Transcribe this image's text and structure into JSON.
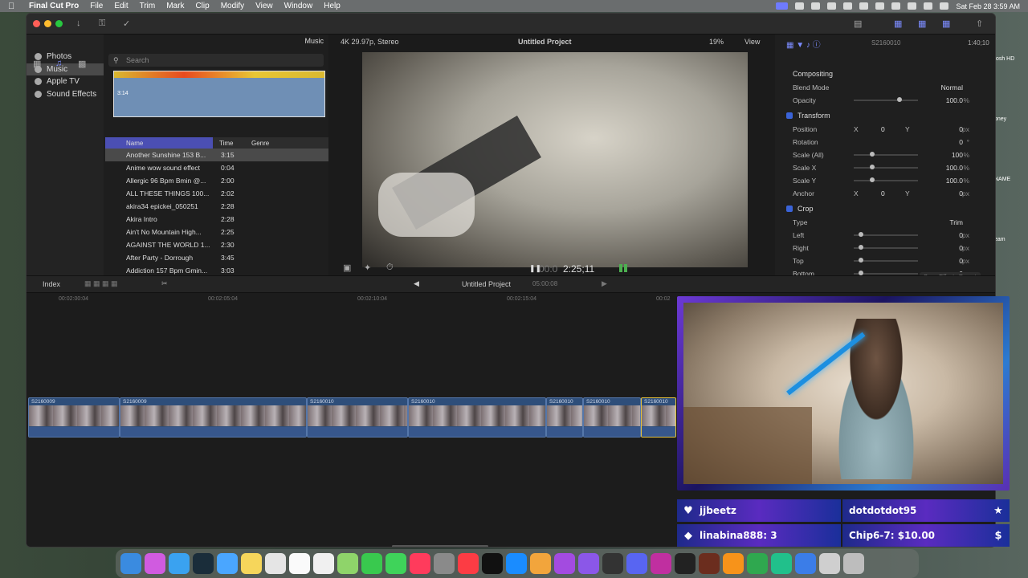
{
  "menubar": {
    "app": "Final Cut Pro",
    "items": [
      "File",
      "Edit",
      "Trim",
      "Mark",
      "Clip",
      "Modify",
      "View",
      "Window",
      "Help"
    ],
    "clock": "Sat Feb 28  3:59 AM"
  },
  "browser": {
    "sidebar": [
      "Photos",
      "Music",
      "Apple TV",
      "Sound Effects"
    ],
    "library_label": "Music",
    "search_placeholder": "Search",
    "waveform_time": "3:14",
    "columns": {
      "name": "Name",
      "time": "Time",
      "genre": "Genre"
    },
    "songs": [
      {
        "name": "Another Sunshine 153 B...",
        "time": "3:15"
      },
      {
        "name": "Anime wow sound effect",
        "time": "0:04"
      },
      {
        "name": "Allergic 96 Bpm Bmin @...",
        "time": "2:00"
      },
      {
        "name": "ALL THESE THINGS 100...",
        "time": "2:02"
      },
      {
        "name": "akira34 epickei_050251",
        "time": "2:28"
      },
      {
        "name": "Akira Intro",
        "time": "2:28"
      },
      {
        "name": "Ain't No Mountain High...",
        "time": "2:25"
      },
      {
        "name": "AGAINST THE WORLD 1...",
        "time": "2:30"
      },
      {
        "name": "After Party - Dorrough",
        "time": "3:45"
      },
      {
        "name": "Addiction 157 Bpm Gmin...",
        "time": "3:03"
      }
    ],
    "footer": "1 file is protected and unavailable"
  },
  "viewer": {
    "format": "4K 29.97p, Stereo",
    "title": "Untitled Project",
    "zoom": "19%",
    "view": "View",
    "timecode_dim": "00:0",
    "timecode": "2:25;11"
  },
  "inspector": {
    "clip_name": "S2160010",
    "duration": "1:40;10",
    "compositing": "Compositing",
    "blend_label": "Blend Mode",
    "blend_value": "Normal",
    "opacity_label": "Opacity",
    "opacity_value": "100.0",
    "transform": "Transform",
    "position_label": "Position",
    "rotation_label": "Rotation",
    "scale_all_label": "Scale (All)",
    "scale_x_label": "Scale X",
    "scale_y_label": "Scale Y",
    "anchor_label": "Anchor",
    "crop": "Crop",
    "type_label": "Type",
    "type_value": "Trim",
    "left_label": "Left",
    "right_label": "Right",
    "top_label": "Top",
    "bottom_label": "Bottom",
    "zero": "0",
    "px": "px",
    "pct": "%",
    "deg": "°",
    "x": "X",
    "y": "Y",
    "hundred": "100",
    "hundred_one": "100.0",
    "save_preset": "Save Effects Preset"
  },
  "timeline": {
    "index": "Index",
    "project": "Untitled Project",
    "duration": "05:00:08",
    "ruler": [
      "00:02:00:04",
      "00:02:05:04",
      "00:02:10:04",
      "00:02:15:04",
      "00:02"
    ],
    "clips": [
      "S2160009",
      "S2160009",
      "S2160010",
      "S2160010",
      "S2160010",
      "S2160010",
      "S2160010"
    ]
  },
  "stream": {
    "alert1_user": "jjbeetz",
    "alert2_user": "dotdotdot95",
    "alert3": "linabina888: 3",
    "alert4": "Chip6-7: $10.00",
    "alert_colors": {
      "bg": "#3b2ab0",
      "accent": "#6f3ad6"
    }
  },
  "desktop": {
    "side_labels": [
      "tosh HD",
      "oney",
      "NAME",
      "eam",
      "rity"
    ]
  },
  "colors": {
    "selection": "#4b4fb3",
    "clip": "#2e4e7a",
    "waveform": "#6f8fb5"
  }
}
